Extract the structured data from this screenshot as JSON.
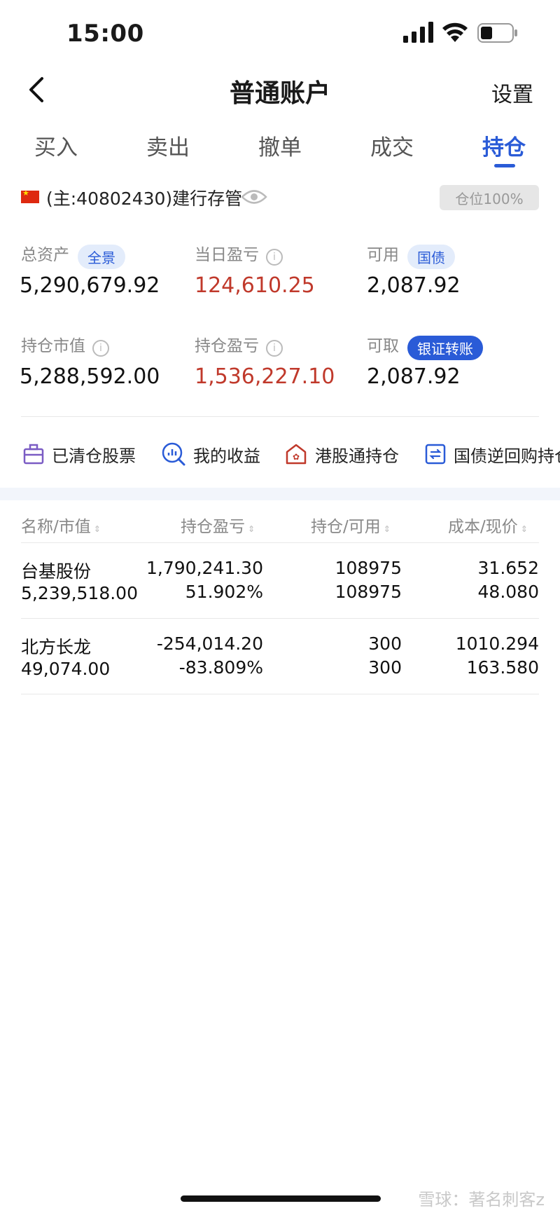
{
  "status_bar": {
    "time": "15:00"
  },
  "nav": {
    "title": "普通账户",
    "settings": "设置"
  },
  "tabs": [
    {
      "label": "买入"
    },
    {
      "label": "卖出"
    },
    {
      "label": "撤单"
    },
    {
      "label": "成交"
    },
    {
      "label": "持仓",
      "active": true
    }
  ],
  "account": {
    "label": "(主:40802430)建行存管",
    "position_badge": "仓位100%"
  },
  "metrics": {
    "total_assets": {
      "label": "总资产",
      "pill": "全景",
      "value": "5,290,679.92"
    },
    "daily_pnl": {
      "label": "当日盈亏",
      "value": "124,610.25"
    },
    "available": {
      "label": "可用",
      "pill": "国债",
      "value": "2,087.92"
    },
    "holding_value": {
      "label": "持仓市值",
      "value": "5,288,592.00"
    },
    "holding_pnl": {
      "label": "持仓盈亏",
      "value": "1,536,227.10"
    },
    "withdrawable": {
      "label": "可取",
      "pill": "银证转账",
      "value": "2,087.92"
    }
  },
  "shortcuts": [
    {
      "label": "已清仓股票",
      "icon": "briefcase-icon"
    },
    {
      "label": "我的收益",
      "icon": "chart-search-icon"
    },
    {
      "label": "港股通持仓",
      "icon": "hk-house-icon"
    },
    {
      "label": "国债逆回购持仓",
      "icon": "repo-cycle-icon"
    }
  ],
  "table": {
    "headers": [
      "名称/市值",
      "持仓盈亏",
      "持仓/可用",
      "成本/现价"
    ],
    "rows": [
      {
        "name": "台基股份",
        "market_value": "5,239,518.00",
        "pnl": "1,790,241.30",
        "pnl_pct": "51.902%",
        "holding": "108975",
        "available": "108975",
        "cost": "31.652",
        "price": "48.080",
        "trend": "up"
      },
      {
        "name": "北方长龙",
        "market_value": "49,074.00",
        "pnl": "-254,014.20",
        "pnl_pct": "-83.809%",
        "holding": "300",
        "available": "300",
        "cost": "1010.294",
        "price": "163.580",
        "trend": "down"
      }
    ]
  },
  "watermark": "雪球：著名刺客z",
  "colors": {
    "accent": "#2a5bd7",
    "up": "#c0392b",
    "down": "#3f8f5f"
  }
}
